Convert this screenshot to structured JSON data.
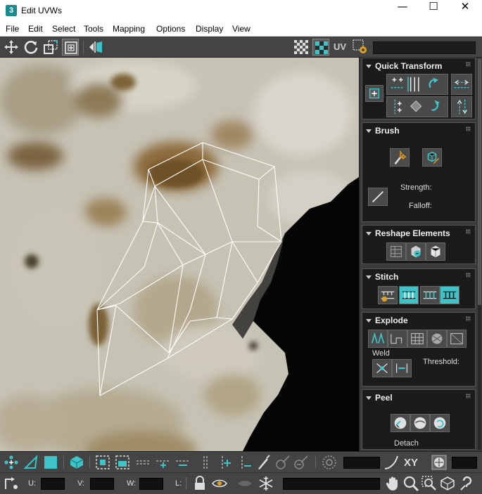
{
  "window": {
    "title": "Edit UVWs",
    "app_icon_glyph": "3",
    "controls": {
      "minimize": "—",
      "maximize": "☐",
      "close": "✕"
    }
  },
  "menu": [
    "File",
    "Edit",
    "Select",
    "Tools",
    "Mapping",
    "Options",
    "Display",
    "View"
  ],
  "toolbar": {
    "uv_label": "UV",
    "icons": [
      "move-icon",
      "rotate-icon",
      "scale-icon",
      "freeform-icon",
      "mirror-icon",
      "checker-pattern-icon",
      "texture-checker-icon",
      "settings-gear-icon"
    ]
  },
  "panel": {
    "quick_transform": {
      "title": "Quick Transform"
    },
    "brush": {
      "title": "Brush",
      "strength_label": "Strength:",
      "falloff_label": "Falloff:"
    },
    "reshape": {
      "title": "Reshape Elements"
    },
    "stitch": {
      "title": "Stitch"
    },
    "explode": {
      "title": "Explode",
      "weld_label": "Weld",
      "threshold_label": "Threshold:"
    },
    "peel": {
      "title": "Peel",
      "detach_label": "Detach"
    }
  },
  "bottom": {
    "xy_label": "XY",
    "u_label": "U:",
    "v_label": "V:",
    "w_label": "W:",
    "l_label": "L:"
  },
  "colors": {
    "accent": "#3ec4c8",
    "panel_bg": "#1b1b1b",
    "toolbar_bg": "#444444",
    "wire": "#ffffff"
  }
}
